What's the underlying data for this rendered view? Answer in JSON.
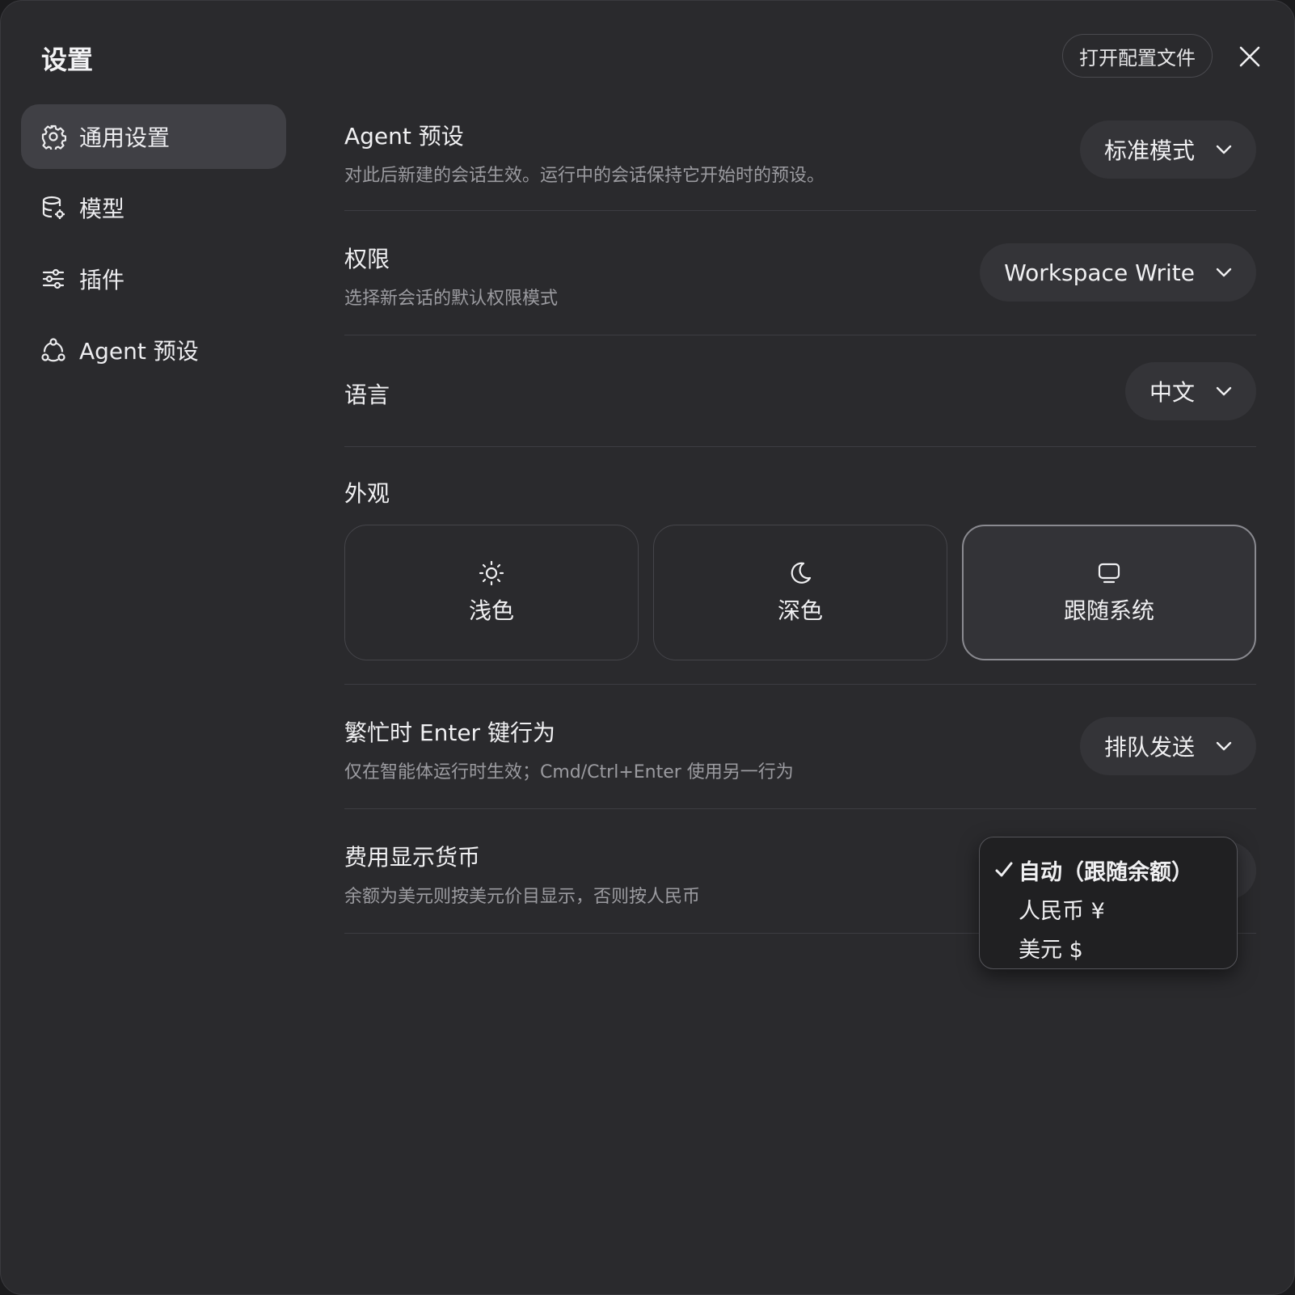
{
  "header": {
    "title": "设置",
    "open_config_label": "打开配置文件"
  },
  "sidebar": {
    "items": [
      {
        "label": "通用设置",
        "icon": "gear-icon",
        "active": true
      },
      {
        "label": "模型",
        "icon": "database-gear-icon",
        "active": false
      },
      {
        "label": "插件",
        "icon": "sliders-icon",
        "active": false
      },
      {
        "label": "Agent 预设",
        "icon": "nodes-icon",
        "active": false
      }
    ]
  },
  "settings": {
    "agent_preset": {
      "label": "Agent 预设",
      "desc": "对此后新建的会话生效。运行中的会话保持它开始时的预设。",
      "value": "标准模式"
    },
    "permissions": {
      "label": "权限",
      "desc": "选择新会话的默认权限模式",
      "value": "Workspace Write"
    },
    "language": {
      "label": "语言",
      "value": "中文"
    },
    "appearance": {
      "label": "外观",
      "options": [
        {
          "label": "浅色",
          "icon": "sun-icon"
        },
        {
          "label": "深色",
          "icon": "moon-icon"
        },
        {
          "label": "跟随系统",
          "icon": "monitor-icon"
        }
      ],
      "selected": "跟随系统"
    },
    "enter_behavior": {
      "label": "繁忙时 Enter 键行为",
      "desc": "仅在智能体运行时生效；Cmd/Ctrl+Enter 使用另一行为",
      "value": "排队发送"
    },
    "currency": {
      "label": "费用显示货币",
      "desc": "余额为美元则按美元价目显示，否则按人民币",
      "options": [
        "自动（跟随余额）",
        "人民币 ¥",
        "美元 $"
      ],
      "selected": "自动（跟随余额）"
    }
  },
  "colors": {
    "window_bg": "#2a2a2d",
    "active_item_bg": "#404045",
    "select_bg": "#343438"
  }
}
